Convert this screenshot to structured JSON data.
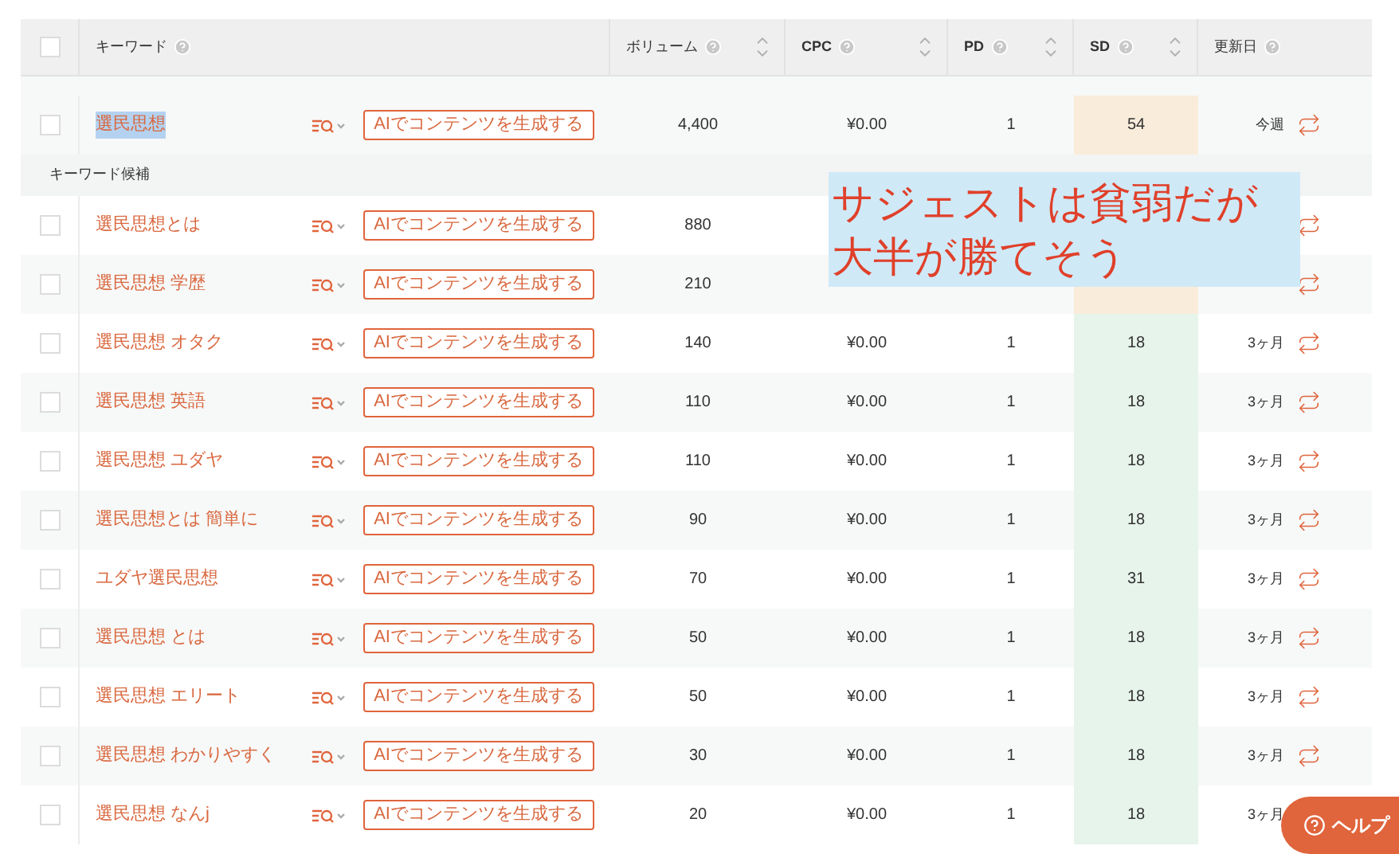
{
  "table": {
    "columns": [
      {
        "label": "キーワード",
        "sortable": false
      },
      {
        "label": "ボリューム",
        "sortable": true
      },
      {
        "label": "CPC",
        "sortable": true
      },
      {
        "label": "PD",
        "sortable": true
      },
      {
        "label": "SD",
        "sortable": true
      },
      {
        "label": "更新日",
        "sortable": false
      }
    ],
    "header_checkbox": {
      "checked": false
    },
    "groups": [
      {
        "rows": [
          {
            "keyword": "選民思想",
            "highlighted": true,
            "checked": false,
            "button": "AIでコンテンツを生成する",
            "volume": "4,400",
            "cpc": "¥0.00",
            "pd": "1",
            "sd": {
              "text": "54",
              "color": "#f9ecdb"
            },
            "updated": "今週"
          }
        ]
      },
      {
        "label": "キーワード候補",
        "rows": [
          {
            "keyword": "選民思想とは",
            "highlighted": false,
            "checked": false,
            "button": "AIでコンテンツを生成する",
            "volume": "880"
          },
          {
            "keyword": "選民思想 学歴",
            "highlighted": false,
            "checked": false,
            "button": "AIでコンテンツを生成する",
            "volume": "210",
            "sd": {
              "color": "#f9ecdb"
            }
          },
          {
            "keyword": "選民思想 オタク",
            "highlighted": false,
            "checked": false,
            "button": "AIでコンテンツを生成する",
            "volume": "140",
            "cpc": "¥0.00",
            "pd": "1",
            "sd": {
              "text": "18",
              "color": "#e6f4ec"
            },
            "updated": "3ヶ月"
          },
          {
            "keyword": "選民思想 英語",
            "highlighted": false,
            "checked": false,
            "button": "AIでコンテンツを生成する",
            "volume": "110",
            "cpc": "¥0.00",
            "pd": "1",
            "sd": {
              "text": "18",
              "color": "#e6f4ec"
            },
            "updated": "3ヶ月"
          },
          {
            "keyword": "選民思想 ユダヤ",
            "highlighted": false,
            "checked": false,
            "button": "AIでコンテンツを生成する",
            "volume": "110",
            "cpc": "¥0.00",
            "pd": "1",
            "sd": {
              "text": "18",
              "color": "#e6f4ec"
            },
            "updated": "3ヶ月"
          },
          {
            "keyword": "選民思想とは 簡単に",
            "highlighted": false,
            "checked": false,
            "button": "AIでコンテンツを生成する",
            "volume": "90",
            "cpc": "¥0.00",
            "pd": "1",
            "sd": {
              "text": "18",
              "color": "#e6f4ec"
            },
            "updated": "3ヶ月"
          },
          {
            "keyword": "ユダヤ選民思想",
            "highlighted": false,
            "checked": false,
            "button": "AIでコンテンツを生成する",
            "volume": "70",
            "cpc": "¥0.00",
            "pd": "1",
            "sd": {
              "text": "31",
              "color": "#e6f4ec"
            },
            "updated": "3ヶ月"
          },
          {
            "keyword": "選民思想 とは",
            "highlighted": false,
            "checked": false,
            "button": "AIでコンテンツを生成する",
            "volume": "50",
            "cpc": "¥0.00",
            "pd": "1",
            "sd": {
              "text": "18",
              "color": "#e6f4ec"
            },
            "updated": "3ヶ月"
          },
          {
            "keyword": "選民思想 エリート",
            "highlighted": false,
            "checked": false,
            "button": "AIでコンテンツを生成する",
            "volume": "50",
            "cpc": "¥0.00",
            "pd": "1",
            "sd": {
              "text": "18",
              "color": "#e6f4ec"
            },
            "updated": "3ヶ月"
          },
          {
            "keyword": "選民思想 わかりやすく",
            "highlighted": false,
            "checked": false,
            "button": "AIでコンテンツを生成する",
            "volume": "30",
            "cpc": "¥0.00",
            "pd": "1",
            "sd": {
              "text": "18",
              "color": "#e6f4ec"
            },
            "updated": "3ヶ月"
          },
          {
            "keyword": "選民思想 なんj",
            "highlighted": false,
            "checked": false,
            "button": "AIでコンテンツを生成する",
            "volume": "20",
            "cpc": "¥0.00",
            "pd": "1",
            "sd": {
              "text": "18",
              "color": "#e6f4ec"
            },
            "updated": "3ヶ月"
          }
        ]
      }
    ]
  },
  "annotation": {
    "lines": [
      "サジェストは貧弱だが",
      "大半が勝てそう"
    ]
  },
  "help_button": {
    "label": "ヘルプ"
  }
}
